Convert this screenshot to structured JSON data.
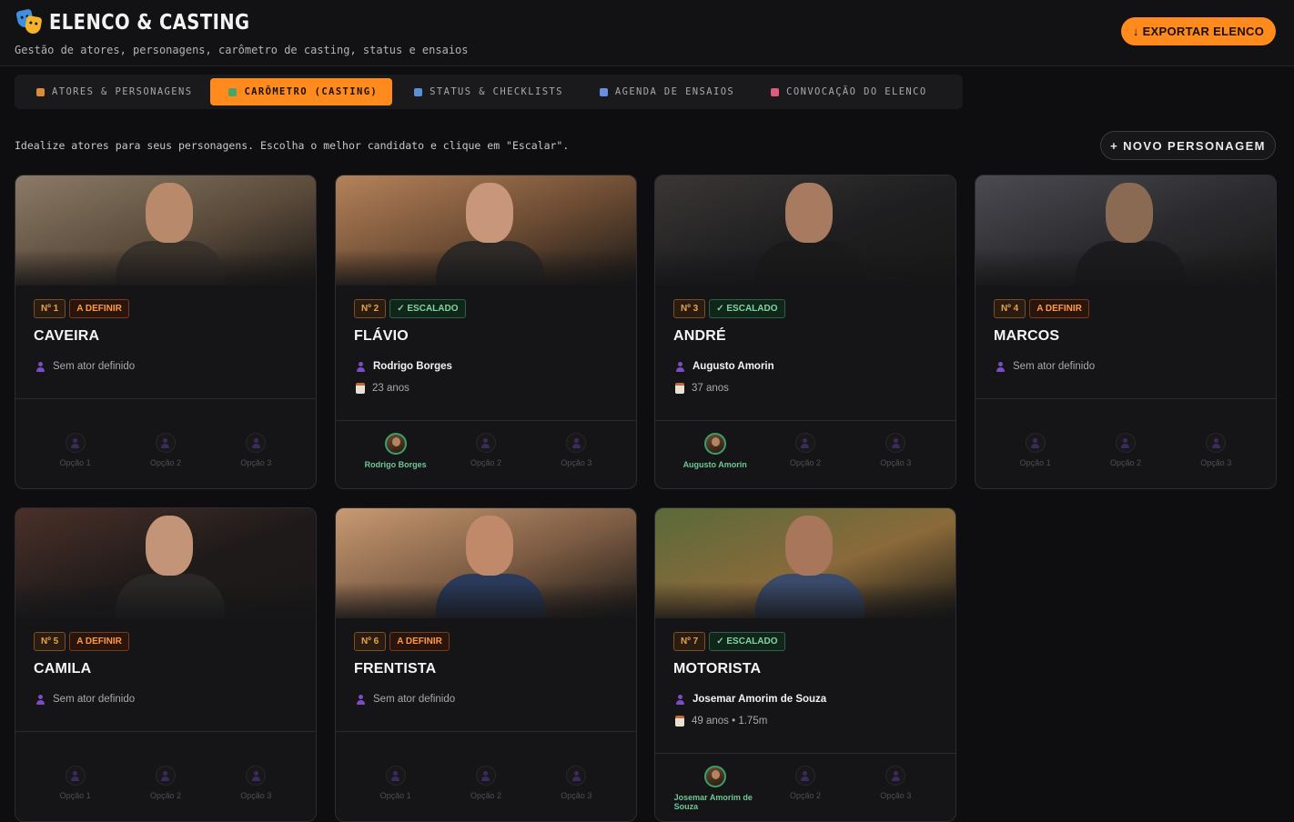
{
  "app": {
    "title": "ELENCO & CASTING",
    "subtitle": "Gestão de atores, personagens, carômetro de casting, status e ensaios",
    "export_label": "↓ EXPORTAR ELENCO"
  },
  "tabs": [
    {
      "label": "ATORES & PERSONAGENS",
      "icon": "theater-masks-icon",
      "color": "#d98a3a"
    },
    {
      "label": "CARÔMETRO (CASTING)",
      "icon": "picture-icon",
      "color": "#4aa36a"
    },
    {
      "label": "STATUS & CHECKLISTS",
      "icon": "bar-chart-icon",
      "color": "#5a8fd6"
    },
    {
      "label": "AGENDA DE ENSAIOS",
      "icon": "calendar-icon",
      "color": "#6a8fe0"
    },
    {
      "label": "CONVOCAÇÃO DO ELENCO",
      "icon": "megaphone-icon",
      "color": "#e05a7a"
    }
  ],
  "intro": "Idealize atores para seus personagens. Escolha o melhor candidato e clique em \"Escalar\".",
  "new_character_label": "+ NOVO PERSONAGEM",
  "cards": [
    {
      "number": "Nº 1",
      "status": "A DEFINIR",
      "status_type": "def",
      "name": "CAVEIRA",
      "actor": "Sem ator definido",
      "details": "",
      "options": [
        "Opção 1",
        "Opção 2",
        "Opção 3"
      ],
      "chosen_index": -1,
      "photo": {
        "bg": "#5a4a3a",
        "bg2": "#8a7a66",
        "face": "#b8896a",
        "body": "#3a332c"
      }
    },
    {
      "number": "Nº 2",
      "status": "✓ ESCALADO",
      "status_type": "esc",
      "name": "FLÁVIO",
      "actor": "Rodrigo Borges",
      "details": "23 anos",
      "options": [
        "Rodrigo Borges",
        "Opção 2",
        "Opção 3"
      ],
      "chosen_index": 0,
      "photo": {
        "bg": "#6a4a32",
        "bg2": "#b4825a",
        "face": "#c8967a",
        "body": "#2e2a28"
      }
    },
    {
      "number": "Nº 3",
      "status": "✓ ESCALADO",
      "status_type": "esc",
      "name": "ANDRÉ",
      "actor": "Augusto Amorin",
      "details": "37 anos",
      "options": [
        "Augusto Amorin",
        "Opção 2",
        "Opção 3"
      ],
      "chosen_index": 0,
      "photo": {
        "bg": "#1e1e20",
        "bg2": "#3a3634",
        "face": "#a87a60",
        "body": "#1a1a1a"
      }
    },
    {
      "number": "Nº 4",
      "status": "A DEFINIR",
      "status_type": "def",
      "name": "MARCOS",
      "actor": "Sem ator definido",
      "details": "",
      "options": [
        "Opção 1",
        "Opção 2",
        "Opção 3"
      ],
      "chosen_index": -1,
      "photo": {
        "bg": "#2a2a2e",
        "bg2": "#4a4a50",
        "face": "#8a6a52",
        "body": "#1c1c1e"
      }
    },
    {
      "number": "Nº 5",
      "status": "A DEFINIR",
      "status_type": "def",
      "name": "CAMILA",
      "actor": "Sem ator definido",
      "details": "",
      "options": [
        "Opção 1",
        "Opção 2",
        "Opção 3"
      ],
      "chosen_index": -1,
      "photo": {
        "bg": "#1e1a1a",
        "bg2": "#4a3028",
        "face": "#c49478",
        "body": "#2a2826"
      }
    },
    {
      "number": "Nº 6",
      "status": "A DEFINIR",
      "status_type": "def",
      "name": "FRENTISTA",
      "actor": "Sem ator definido",
      "details": "",
      "options": [
        "Opção 1",
        "Opção 2",
        "Opção 3"
      ],
      "chosen_index": -1,
      "photo": {
        "bg": "#7a5a42",
        "bg2": "#c89a72",
        "face": "#c08a6a",
        "body": "#2a3a5a"
      }
    },
    {
      "number": "Nº 7",
      "status": "✓ ESCALADO",
      "status_type": "esc",
      "name": "MOTORISTA",
      "actor": "Josemar Amorim de Souza",
      "details": "49 anos • 1.75m",
      "options": [
        "Josemar Amorim de Souza",
        "Opção 2",
        "Opção 3"
      ],
      "chosen_index": 0,
      "photo": {
        "bg": "#8a6a3a",
        "bg2": "#5a6a3a",
        "face": "#a8765a",
        "body": "#3a4a6a"
      }
    }
  ]
}
